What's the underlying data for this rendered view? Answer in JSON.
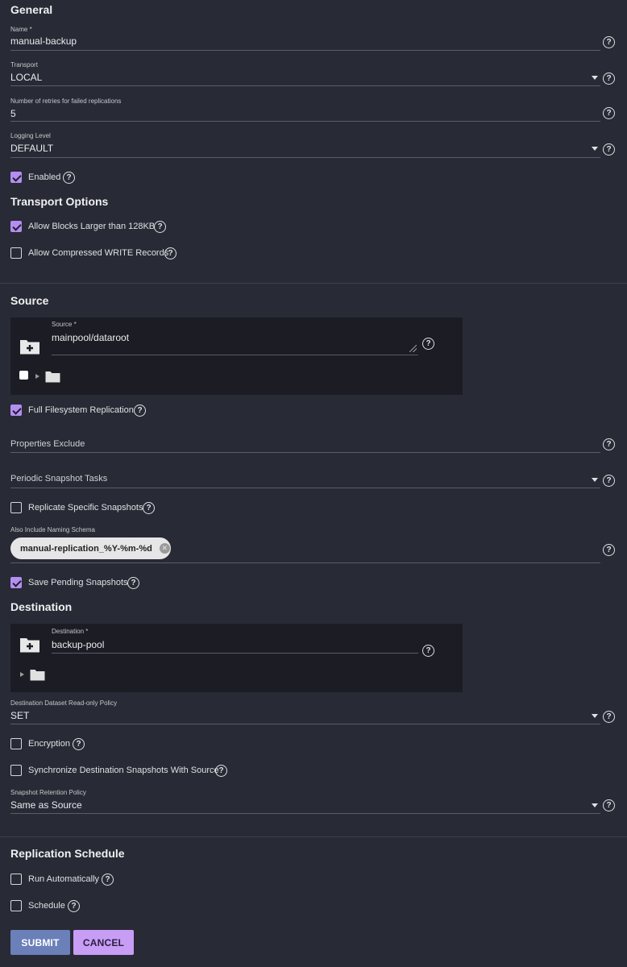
{
  "general": {
    "heading": "General",
    "name": {
      "label": "Name *",
      "value": "manual-backup"
    },
    "transport": {
      "label": "Transport",
      "value": "LOCAL"
    },
    "retries": {
      "label": "Number of retries for failed replications",
      "value": "5"
    },
    "logging": {
      "label": "Logging Level",
      "value": "DEFAULT"
    },
    "enabled": {
      "label": "Enabled",
      "checked": true
    }
  },
  "transport_options": {
    "heading": "Transport Options",
    "large_blocks": {
      "label": "Allow Blocks Larger than 128KB",
      "checked": true
    },
    "compressed": {
      "label": "Allow Compressed WRITE Records",
      "checked": false
    }
  },
  "source": {
    "heading": "Source",
    "field": {
      "label": "Source *",
      "value": "mainpool/dataroot"
    },
    "full_fs": {
      "label": "Full Filesystem Replication",
      "checked": true
    },
    "properties_exclude": {
      "label": "Properties Exclude"
    },
    "periodic_tasks": {
      "label": "Periodic Snapshot Tasks"
    },
    "replicate_specific": {
      "label": "Replicate Specific Snapshots",
      "checked": false
    },
    "naming_schema": {
      "label": "Also Include Naming Schema",
      "chip": "manual-replication_%Y-%m-%d"
    },
    "save_pending": {
      "label": "Save Pending Snapshots",
      "checked": true
    }
  },
  "destination": {
    "heading": "Destination",
    "field": {
      "label": "Destination *",
      "value": "backup-pool"
    },
    "readonly_policy": {
      "label": "Destination Dataset Read-only Policy",
      "value": "SET"
    },
    "encryption": {
      "label": "Encryption",
      "checked": false
    },
    "sync_snapshots": {
      "label": "Synchronize Destination Snapshots With Source",
      "checked": false
    },
    "retention": {
      "label": "Snapshot Retention Policy",
      "value": "Same as Source"
    }
  },
  "schedule": {
    "heading": "Replication Schedule",
    "run_auto": {
      "label": "Run Automatically",
      "checked": false
    },
    "schedule": {
      "label": "Schedule",
      "checked": false
    }
  },
  "actions": {
    "submit": "SUBMIT",
    "cancel": "CANCEL"
  },
  "colors": {
    "background": "#282a36",
    "accent": "#b48ef0",
    "submit": "#6b7fb8",
    "cancel": "#c79df5"
  }
}
